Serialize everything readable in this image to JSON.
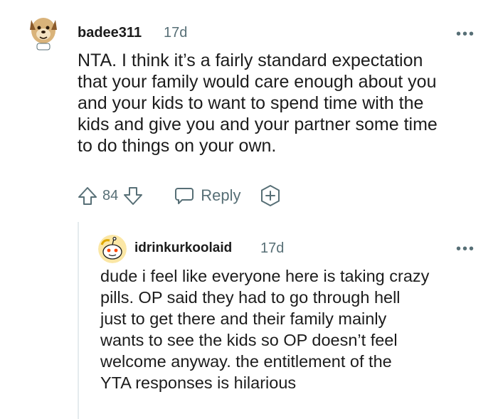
{
  "comment": {
    "username": "badee311",
    "timestamp": "17d",
    "body": "NTA. I think it’s a fairly standard expectation\nthat your family would care enough about you\nand your kids to want to spend time with the\nkids and give you and your partner some time\nto do things on your own.",
    "votes": "84",
    "reply_label": "Reply",
    "more_label": "•••"
  },
  "reply": {
    "username": "idrinkurkoolaid",
    "timestamp": "17d",
    "body": "dude i feel like everyone here is taking crazy\npills. OP said they had to go through hell\njust to get there and their family mainly\nwants to see the kids so OP doesn’t feel\nwelcome anyway. the entitlement of the\nYTA responses is hilarious",
    "more_label": "•••"
  },
  "icons": {
    "avatar1": "dog-avatar-icon",
    "avatar2": "snoo-avatar-icon",
    "upvote": "upvote-arrow-icon",
    "downvote": "downvote-arrow-icon",
    "reply": "speech-bubble-icon",
    "award": "add-award-icon",
    "more": "more-options-icon"
  },
  "colors": {
    "text": "#1c1c1c",
    "meta": "#576f76",
    "thread_line": "#e5ebee"
  }
}
